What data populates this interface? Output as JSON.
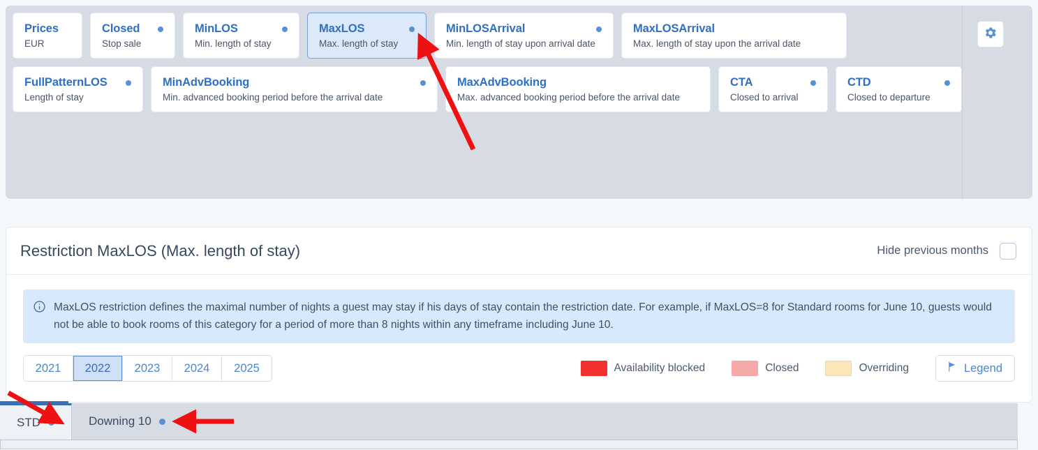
{
  "restriction_types": {
    "cards": [
      {
        "title": "Prices",
        "subtitle": "EUR",
        "dot": false,
        "selected": false,
        "width_class": "w-prices"
      },
      {
        "title": "Closed",
        "subtitle": "Stop sale",
        "dot": true,
        "selected": false,
        "width_class": "w-closed"
      },
      {
        "title": "MinLOS",
        "subtitle": "Min. length of stay",
        "dot": true,
        "selected": false,
        "width_class": "w-minlos"
      },
      {
        "title": "MaxLOS",
        "subtitle": "Max. length of stay",
        "dot": true,
        "selected": true,
        "width_class": "w-maxlos"
      },
      {
        "title": "MinLOSArrival",
        "subtitle": "Min. length of stay upon arrival date",
        "dot": true,
        "selected": false,
        "width_class": "w-minlosa"
      },
      {
        "title": "MaxLOSArrival",
        "subtitle": "Max. length of stay upon the arrival date",
        "dot": false,
        "selected": false,
        "width_class": "w-maxlosa"
      },
      {
        "title": "FullPatternLOS",
        "subtitle": "Length of stay",
        "dot": true,
        "selected": false,
        "width_class": "w-fullpat"
      },
      {
        "title": "MinAdvBooking",
        "subtitle": "Min. advanced booking period before the arrival date",
        "dot": true,
        "selected": false,
        "width_class": "w-minadv"
      },
      {
        "title": "MaxAdvBooking",
        "subtitle": "Max. advanced booking period before the arrival date",
        "dot": false,
        "selected": false,
        "width_class": "w-maxadv"
      },
      {
        "title": "CTA",
        "subtitle": "Closed to arrival",
        "dot": true,
        "selected": false,
        "width_class": "w-cta"
      },
      {
        "title": "CTD",
        "subtitle": "Closed to departure",
        "dot": true,
        "selected": false,
        "width_class": "w-ctd"
      }
    ],
    "settings_icon": "gear-icon"
  },
  "panel": {
    "title": "Restriction MaxLOS (Max. length of stay)",
    "hide_previous_months_label": "Hide previous months",
    "hide_previous_months_checked": false,
    "info_icon": "info-circle-icon",
    "info_text": "MaxLOS restriction defines the maximal number of nights a guest may stay if his days of stay contain the restriction date. For example, if MaxLOS=8 for Standard rooms for June 10, guests would not be able to book rooms of this category for a period of more than 8 nights within any timeframe including June 10."
  },
  "years": {
    "options": [
      "2021",
      "2022",
      "2023",
      "2024",
      "2025"
    ],
    "selected": "2022"
  },
  "legend": {
    "items": [
      {
        "label": "Availability blocked",
        "color": "#f23030"
      },
      {
        "label": "Closed",
        "color": "#f5a8a8"
      },
      {
        "label": "Overriding",
        "color": "#fbe6b8"
      }
    ],
    "button_label": "Legend",
    "button_icon": "flag-icon"
  },
  "room_tabs": {
    "items": [
      {
        "label": "STD",
        "dot": true,
        "active": true
      },
      {
        "label": "Downing 10",
        "dot": true,
        "active": false
      }
    ]
  },
  "colors": {
    "accent": "#3a6eb5",
    "card_title": "#2f6fc4",
    "selected_card_bg": "#dbe9fa",
    "panel_bg": "#d7dce4",
    "info_bg": "#d7e9fb",
    "page_bg": "#f4f8fb",
    "annotation_arrow": "#ee1111"
  }
}
